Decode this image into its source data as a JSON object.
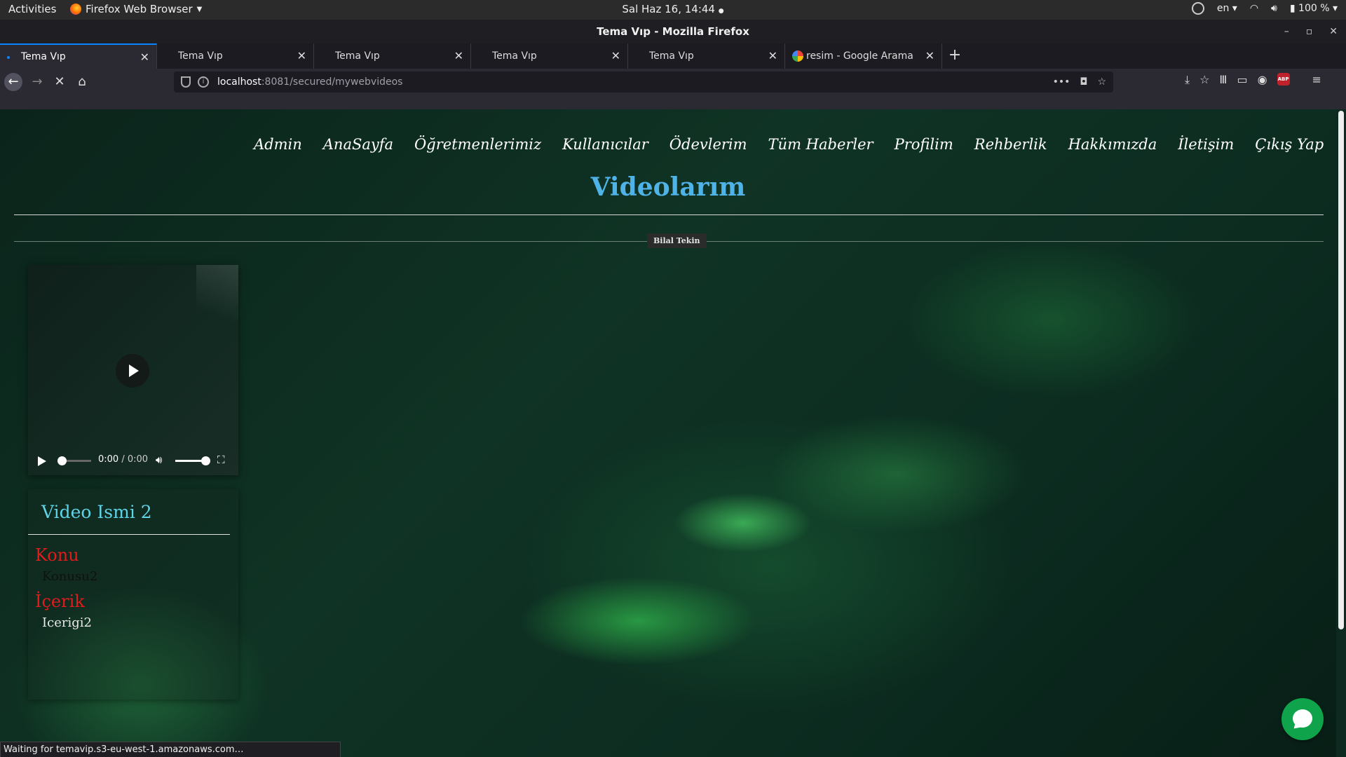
{
  "os": {
    "activities": "Activities",
    "app_menu": "Firefox Web Browser",
    "clock": "Sal Haz 16, 14:44",
    "keyboard_layout": "en",
    "battery": "100 %"
  },
  "window": {
    "title": "Tema Vıp - Mozilla Firefox"
  },
  "tabs": [
    {
      "label": "Tema Vıp",
      "active": true
    },
    {
      "label": "Tema Vıp"
    },
    {
      "label": "Tema Vıp"
    },
    {
      "label": "Tema Vıp"
    },
    {
      "label": "Tema Vıp"
    },
    {
      "label": "resim - Google Arama"
    }
  ],
  "url": {
    "host": "localhost",
    "rest": ":8081/secured/mywebvideos"
  },
  "site": {
    "menu": [
      "Admin",
      "AnaSayfa",
      "Öğretmenlerimiz",
      "Kullanıcılar",
      "Ödevlerim",
      "Tüm Haberler",
      "Profilim",
      "Rehberlik",
      "Hakkımızda",
      "İletişim",
      "Çıkış Yap"
    ],
    "page_title": "Videolarım",
    "author": "Bilal Tekin"
  },
  "video": {
    "time_current": "0:00",
    "time_total": "0:00",
    "title": "Video Ismi 2",
    "topic_heading": "Konu",
    "topic_value": "Konusu2",
    "content_heading": "İçerik",
    "content_value": "Icerigi2"
  },
  "status_text": "Waiting for temavip.s3-eu-west-1.amazonaws.com…",
  "colors": {
    "page_title": "#4fb3e8",
    "video_title": "#5fd3e8",
    "heading_red": "#e21b1b",
    "chat_button": "#0fa34b",
    "tab_accent": "#0a84ff"
  }
}
